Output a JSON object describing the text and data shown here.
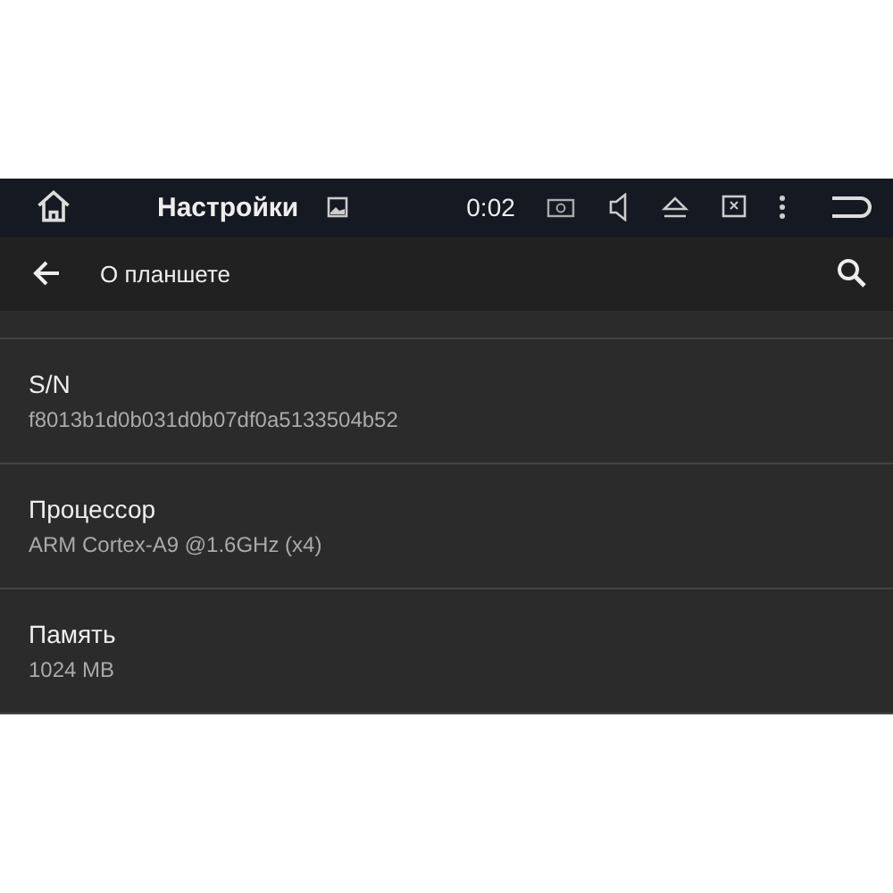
{
  "status_bar": {
    "title": "Настройки",
    "time": "0:02"
  },
  "toolbar": {
    "title": "О планшете"
  },
  "items": [
    {
      "title": "S/N",
      "summary": "f8013b1d0b031d0b07df0a5133504b52"
    },
    {
      "title": "Процессор",
      "summary": "ARM Cortex-A9 @1.6GHz (x4)"
    },
    {
      "title": "Память",
      "summary": "1024 MB"
    }
  ]
}
